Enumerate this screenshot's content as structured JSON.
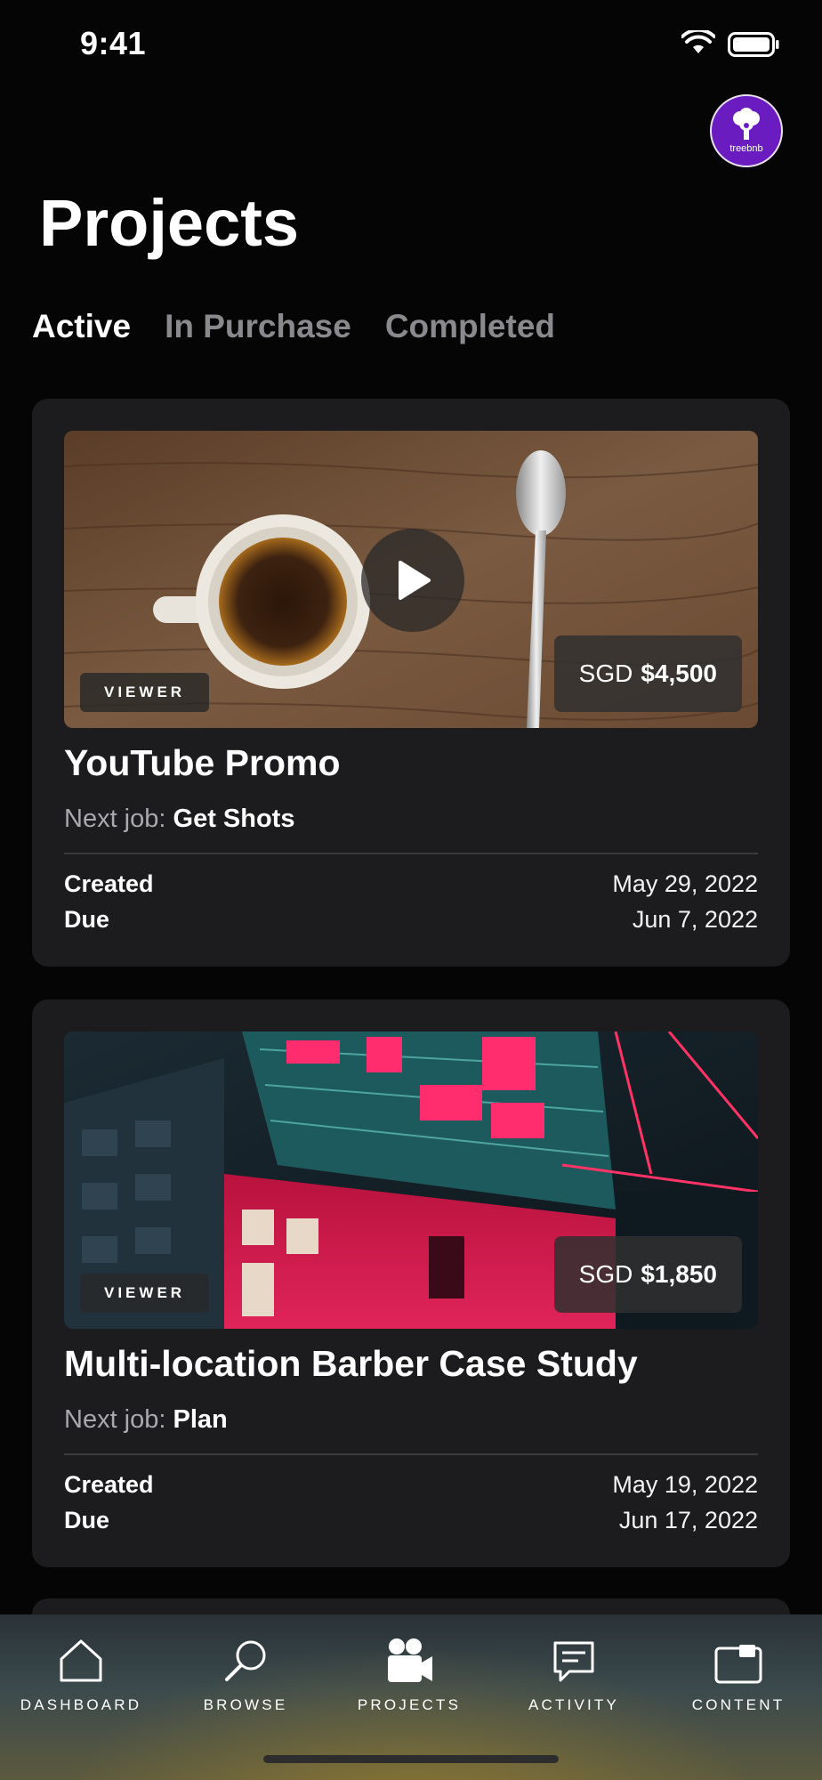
{
  "status_bar": {
    "time": "9:41"
  },
  "avatar": {
    "brand": "treebnb"
  },
  "page": {
    "title": "Projects"
  },
  "tabs": [
    {
      "label": "Active",
      "active": true
    },
    {
      "label": "In Purchase",
      "active": false
    },
    {
      "label": "Completed",
      "active": false
    }
  ],
  "projects": [
    {
      "title": "YouTube Promo",
      "role": "VIEWER",
      "currency": "SGD",
      "price": "$4,500",
      "next_job_label": "Next job:",
      "next_job": "Get Shots",
      "created_label": "Created",
      "created": "May 29, 2022",
      "due_label": "Due",
      "due": "Jun 7, 2022",
      "has_video": true
    },
    {
      "title": "Multi-location Barber Case Study",
      "role": "VIEWER",
      "currency": "SGD",
      "price": "$1,850",
      "next_job_label": "Next job:",
      "next_job": "Plan",
      "created_label": "Created",
      "created": "May 19, 2022",
      "due_label": "Due",
      "due": "Jun 17, 2022",
      "has_video": false
    }
  ],
  "nav": [
    {
      "label": "DASHBOARD",
      "icon": "home-icon",
      "active": false
    },
    {
      "label": "BROWSE",
      "icon": "search-icon",
      "active": false
    },
    {
      "label": "PROJECTS",
      "icon": "video-camera-icon",
      "active": true
    },
    {
      "label": "ACTIVITY",
      "icon": "message-icon",
      "active": false
    },
    {
      "label": "CONTENT",
      "icon": "media-folder-icon",
      "active": false
    }
  ]
}
